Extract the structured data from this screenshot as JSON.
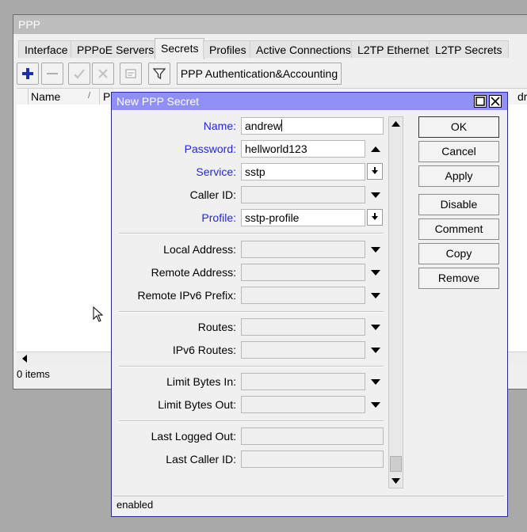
{
  "main_window": {
    "title": "PPP",
    "tabs": [
      {
        "label": "Interface"
      },
      {
        "label": "PPPoE Servers"
      },
      {
        "label": "Secrets"
      },
      {
        "label": "Profiles"
      },
      {
        "label": "Active Connections"
      },
      {
        "label": "L2TP Ethernet"
      },
      {
        "label": "L2TP Secrets"
      }
    ],
    "active_tab": "Secrets",
    "toolbar": {
      "add_icon": "plus-icon",
      "remove_icon": "minus-icon",
      "enable_icon": "check-icon",
      "disable_icon": "x-icon",
      "comment_icon": "note-icon",
      "filter_icon": "filter-icon",
      "accounting_label": "PPP Authentication&Accounting"
    },
    "columns": [
      {
        "label": "Name"
      },
      {
        "label": "Pa"
      },
      {
        "label": "dres"
      }
    ],
    "status": "0 items"
  },
  "dialog": {
    "title": "New PPP Secret",
    "fields": {
      "name": {
        "label": "Name:",
        "value": "andrew"
      },
      "password": {
        "label": "Password:",
        "value": "hellworld123"
      },
      "service": {
        "label": "Service:",
        "value": "sstp"
      },
      "caller_id": {
        "label": "Caller ID:",
        "value": ""
      },
      "profile": {
        "label": "Profile:",
        "value": "sstp-profile"
      },
      "local_address": {
        "label": "Local Address:",
        "value": ""
      },
      "remote_address": {
        "label": "Remote Address:",
        "value": ""
      },
      "remote_ipv6_prefix": {
        "label": "Remote IPv6 Prefix:",
        "value": ""
      },
      "routes": {
        "label": "Routes:",
        "value": ""
      },
      "ipv6_routes": {
        "label": "IPv6 Routes:",
        "value": ""
      },
      "limit_bytes_in": {
        "label": "Limit Bytes In:",
        "value": ""
      },
      "limit_bytes_out": {
        "label": "Limit Bytes Out:",
        "value": ""
      },
      "last_logged_out": {
        "label": "Last Logged Out:",
        "value": ""
      },
      "last_caller_id": {
        "label": "Last Caller ID:",
        "value": ""
      }
    },
    "buttons": {
      "ok": "OK",
      "cancel": "Cancel",
      "apply": "Apply",
      "disable": "Disable",
      "comment": "Comment",
      "copy": "Copy",
      "remove": "Remove"
    },
    "status": "enabled"
  },
  "colors": {
    "dialog_title_bg": "#8f8ff5",
    "label_blue": "#2525d6",
    "main_title_bg": "#bdbdbd"
  }
}
